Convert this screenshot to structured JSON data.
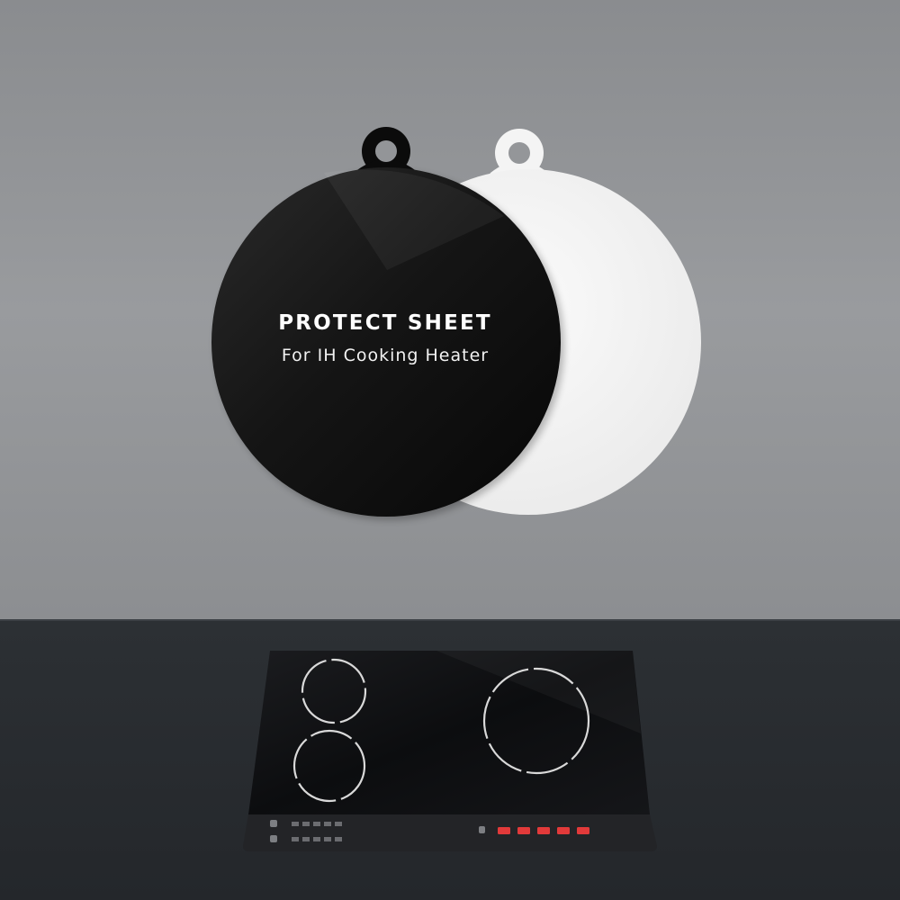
{
  "product": {
    "title": "PROTECT SHEET",
    "subtitle": "For IH Cooking Heater"
  },
  "colors": {
    "wall": "#8f9194",
    "counter": "#2a2d31",
    "sheet_black": "#0b0b0b",
    "sheet_white": "#f4f4f4",
    "cooktop": "#0e0f11",
    "indicator_red": "#e23a3a"
  },
  "cooktop": {
    "burners": [
      "small-burner-top-left",
      "small-burner-bottom-left",
      "large-burner-right"
    ],
    "indicator_count": 5
  }
}
